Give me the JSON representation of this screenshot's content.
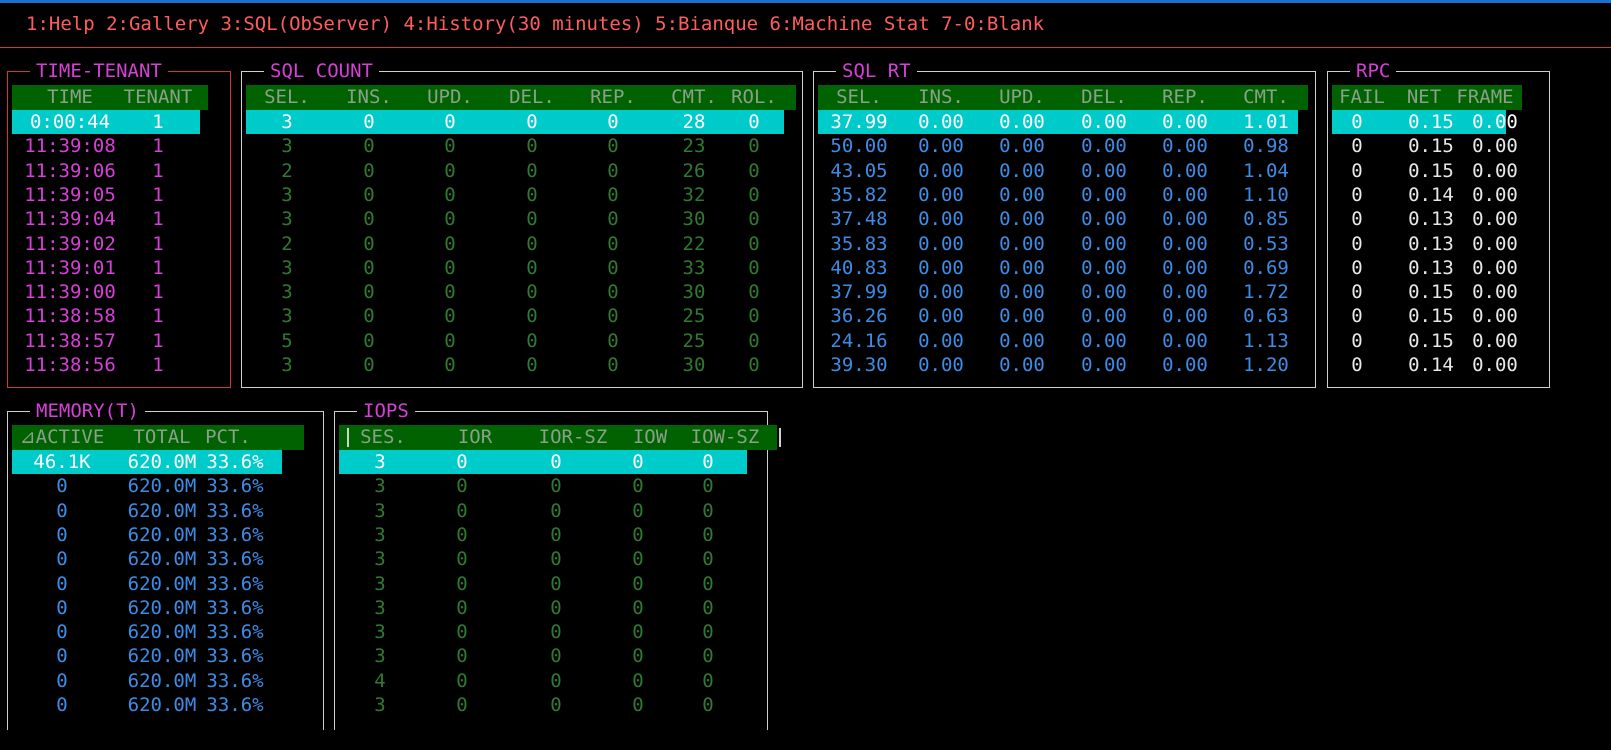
{
  "menubar": "1:Help 2:Gallery 3:SQL(ObServer) 4:History(30 minutes) 5:Bianque 6:Machine Stat 7-0:Blank",
  "panels": {
    "time_tenant": {
      "title": "TIME-TENANT",
      "headers": [
        "TIME",
        "TENANT"
      ],
      "rows": [
        [
          "0:00:44",
          "1"
        ],
        [
          "11:39:08",
          "1"
        ],
        [
          "11:39:06",
          "1"
        ],
        [
          "11:39:05",
          "1"
        ],
        [
          "11:39:04",
          "1"
        ],
        [
          "11:39:02",
          "1"
        ],
        [
          "11:39:01",
          "1"
        ],
        [
          "11:39:00",
          "1"
        ],
        [
          "11:38:58",
          "1"
        ],
        [
          "11:38:57",
          "1"
        ],
        [
          "11:38:56",
          "1"
        ]
      ]
    },
    "sql_count": {
      "title": "SQL COUNT",
      "headers": [
        "SEL.",
        "INS.",
        "UPD.",
        "DEL.",
        "REP.",
        "CMT.",
        "ROL."
      ],
      "rows": [
        [
          "3",
          "0",
          "0",
          "0",
          "0",
          "28",
          "0"
        ],
        [
          "3",
          "0",
          "0",
          "0",
          "0",
          "23",
          "0"
        ],
        [
          "2",
          "0",
          "0",
          "0",
          "0",
          "26",
          "0"
        ],
        [
          "3",
          "0",
          "0",
          "0",
          "0",
          "32",
          "0"
        ],
        [
          "3",
          "0",
          "0",
          "0",
          "0",
          "30",
          "0"
        ],
        [
          "2",
          "0",
          "0",
          "0",
          "0",
          "22",
          "0"
        ],
        [
          "3",
          "0",
          "0",
          "0",
          "0",
          "33",
          "0"
        ],
        [
          "3",
          "0",
          "0",
          "0",
          "0",
          "30",
          "0"
        ],
        [
          "3",
          "0",
          "0",
          "0",
          "0",
          "25",
          "0"
        ],
        [
          "5",
          "0",
          "0",
          "0",
          "0",
          "25",
          "0"
        ],
        [
          "3",
          "0",
          "0",
          "0",
          "0",
          "30",
          "0"
        ]
      ]
    },
    "sql_rt": {
      "title": "SQL RT",
      "headers": [
        "SEL.",
        "INS.",
        "UPD.",
        "DEL.",
        "REP.",
        "CMT."
      ],
      "rows": [
        [
          "37.99",
          "0.00",
          "0.00",
          "0.00",
          "0.00",
          "1.01"
        ],
        [
          "50.00",
          "0.00",
          "0.00",
          "0.00",
          "0.00",
          "0.98"
        ],
        [
          "43.05",
          "0.00",
          "0.00",
          "0.00",
          "0.00",
          "1.04"
        ],
        [
          "35.82",
          "0.00",
          "0.00",
          "0.00",
          "0.00",
          "1.10"
        ],
        [
          "37.48",
          "0.00",
          "0.00",
          "0.00",
          "0.00",
          "0.85"
        ],
        [
          "35.83",
          "0.00",
          "0.00",
          "0.00",
          "0.00",
          "0.53"
        ],
        [
          "40.83",
          "0.00",
          "0.00",
          "0.00",
          "0.00",
          "0.69"
        ],
        [
          "37.99",
          "0.00",
          "0.00",
          "0.00",
          "0.00",
          "1.72"
        ],
        [
          "36.26",
          "0.00",
          "0.00",
          "0.00",
          "0.00",
          "0.63"
        ],
        [
          "24.16",
          "0.00",
          "0.00",
          "0.00",
          "0.00",
          "1.13"
        ],
        [
          "39.30",
          "0.00",
          "0.00",
          "0.00",
          "0.00",
          "1.20"
        ]
      ]
    },
    "rpc": {
      "title": "RPC",
      "headers": [
        "FAIL",
        "NET",
        "FRAME"
      ],
      "rows": [
        [
          "0",
          "0.15",
          "0.00"
        ],
        [
          "0",
          "0.15",
          "0.00"
        ],
        [
          "0",
          "0.15",
          "0.00"
        ],
        [
          "0",
          "0.14",
          "0.00"
        ],
        [
          "0",
          "0.13",
          "0.00"
        ],
        [
          "0",
          "0.13",
          "0.00"
        ],
        [
          "0",
          "0.13",
          "0.00"
        ],
        [
          "0",
          "0.15",
          "0.00"
        ],
        [
          "0",
          "0.15",
          "0.00"
        ],
        [
          "0",
          "0.15",
          "0.00"
        ],
        [
          "0",
          "0.14",
          "0.00"
        ]
      ]
    },
    "memory": {
      "title": "MEMORY(T)",
      "headers": [
        "⊿ACTIVE",
        "TOTAL",
        "PCT."
      ],
      "rows": [
        [
          "46.1K",
          "620.0M",
          "33.6%"
        ],
        [
          "0",
          "620.0M",
          "33.6%"
        ],
        [
          "0",
          "620.0M",
          "33.6%"
        ],
        [
          "0",
          "620.0M",
          "33.6%"
        ],
        [
          "0",
          "620.0M",
          "33.6%"
        ],
        [
          "0",
          "620.0M",
          "33.6%"
        ],
        [
          "0",
          "620.0M",
          "33.6%"
        ],
        [
          "0",
          "620.0M",
          "33.6%"
        ],
        [
          "0",
          "620.0M",
          "33.6%"
        ],
        [
          "0",
          "620.0M",
          "33.6%"
        ],
        [
          "0",
          "620.0M",
          "33.6%"
        ]
      ]
    },
    "iops": {
      "title": "IOPS",
      "headers": [
        "SES.",
        "IOR",
        "IOR-SZ",
        "IOW",
        "IOW-SZ"
      ],
      "rows": [
        [
          "3",
          "0",
          "0",
          "0",
          "0"
        ],
        [
          "3",
          "0",
          "0",
          "0",
          "0"
        ],
        [
          "3",
          "0",
          "0",
          "0",
          "0"
        ],
        [
          "3",
          "0",
          "0",
          "0",
          "0"
        ],
        [
          "3",
          "0",
          "0",
          "0",
          "0"
        ],
        [
          "3",
          "0",
          "0",
          "0",
          "0"
        ],
        [
          "3",
          "0",
          "0",
          "0",
          "0"
        ],
        [
          "3",
          "0",
          "0",
          "0",
          "0"
        ],
        [
          "3",
          "0",
          "0",
          "0",
          "0"
        ],
        [
          "4",
          "0",
          "0",
          "0",
          "0"
        ],
        [
          "3",
          "0",
          "0",
          "0",
          "0"
        ]
      ]
    }
  },
  "colors": {
    "background": "#000000",
    "menu_text": "#ff5d5d",
    "panel_title": "#d640d6",
    "header_bg": "#006200",
    "selected_row_bg": "#00cbcb",
    "value_green": "#2f7a2f",
    "value_blue": "#3d8ce6",
    "value_magenta": "#d640d6"
  }
}
